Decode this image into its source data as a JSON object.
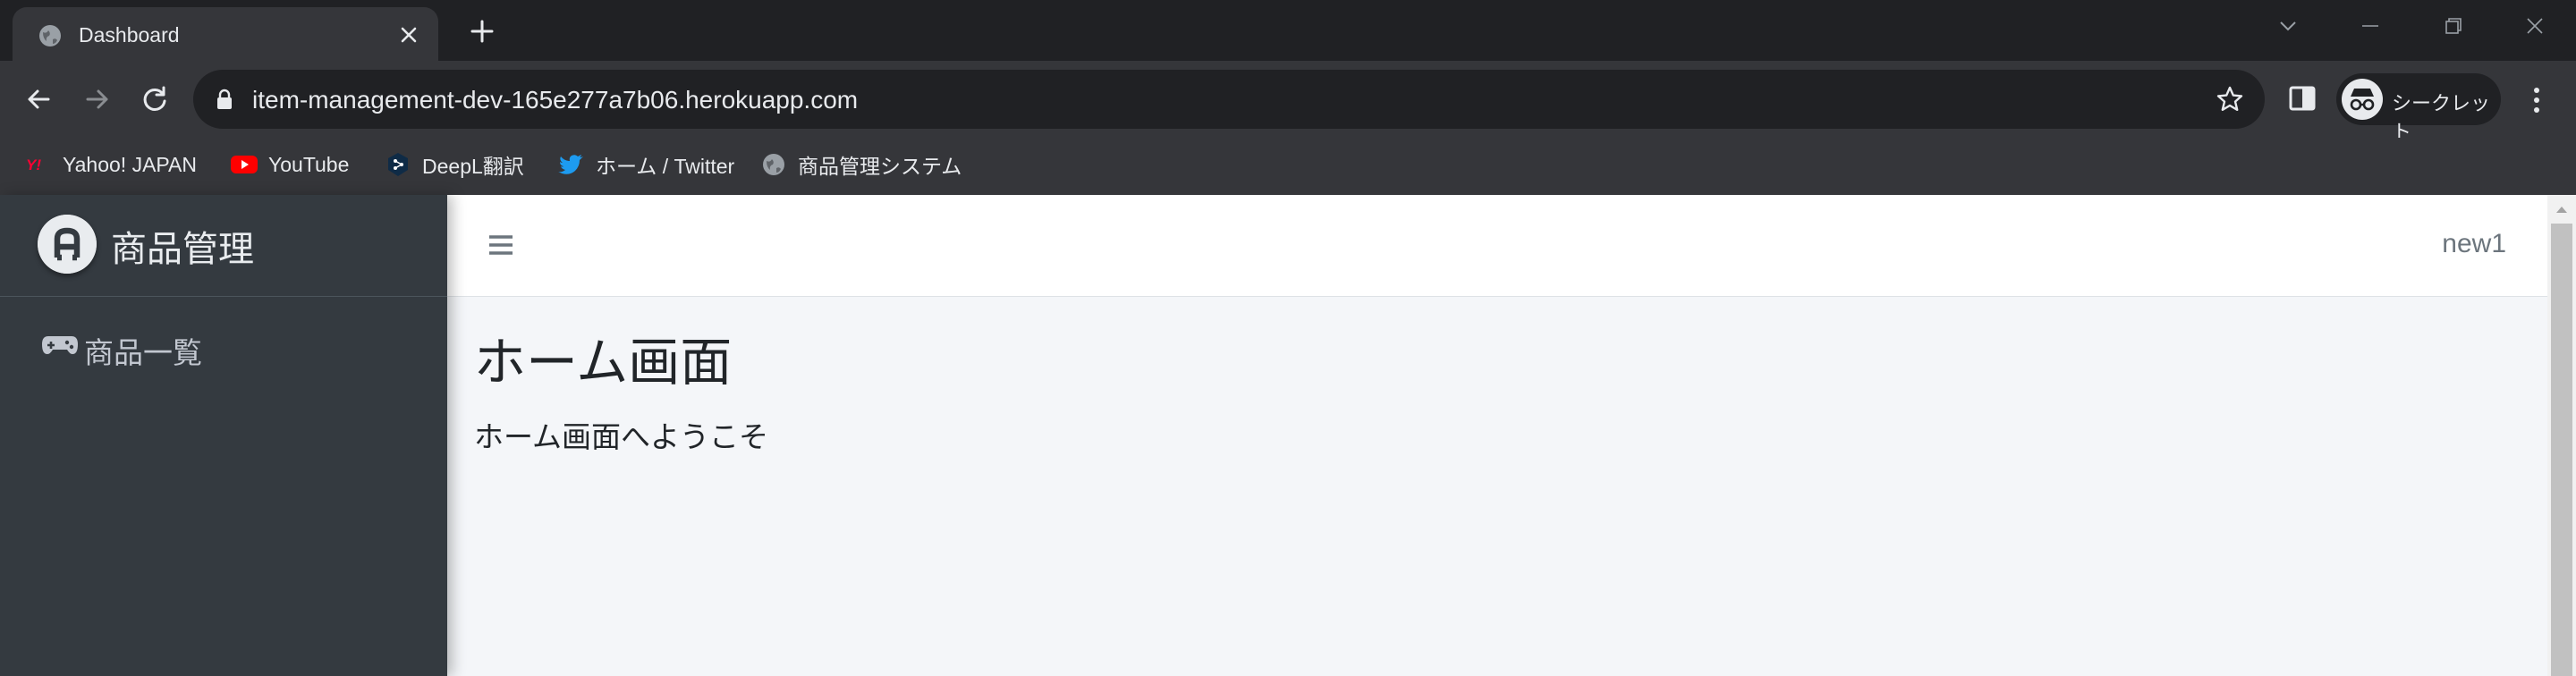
{
  "browser": {
    "tab_title": "Dashboard",
    "url": "item-management-dev-165e277a7b06.herokuapp.com",
    "incognito_label": "シークレット",
    "bookmarks": [
      {
        "label": "Yahoo! JAPAN",
        "icon": "yahoo-icon"
      },
      {
        "label": "YouTube",
        "icon": "youtube-icon"
      },
      {
        "label": "DeepL翻訳",
        "icon": "deepl-icon"
      },
      {
        "label": "ホーム / Twitter",
        "icon": "twitter-icon"
      },
      {
        "label": "商品管理システム",
        "icon": "globe-icon"
      }
    ]
  },
  "sidebar": {
    "brand": "商品管理",
    "items": [
      {
        "label": "商品一覧",
        "icon": "gamepad-icon"
      }
    ]
  },
  "header": {
    "user": "new1"
  },
  "main": {
    "title": "ホーム画面",
    "welcome": "ホーム画面へようこそ"
  },
  "colors": {
    "chrome_dark": "#202124",
    "chrome_toolbar": "#35363a",
    "sidebar_bg": "#343a40",
    "content_bg": "#f4f6f9",
    "youtube_red": "#ff0000",
    "yahoo_red": "#ff0033",
    "twitter_blue": "#1d9bf0",
    "deepl_blue": "#0f2b46"
  }
}
